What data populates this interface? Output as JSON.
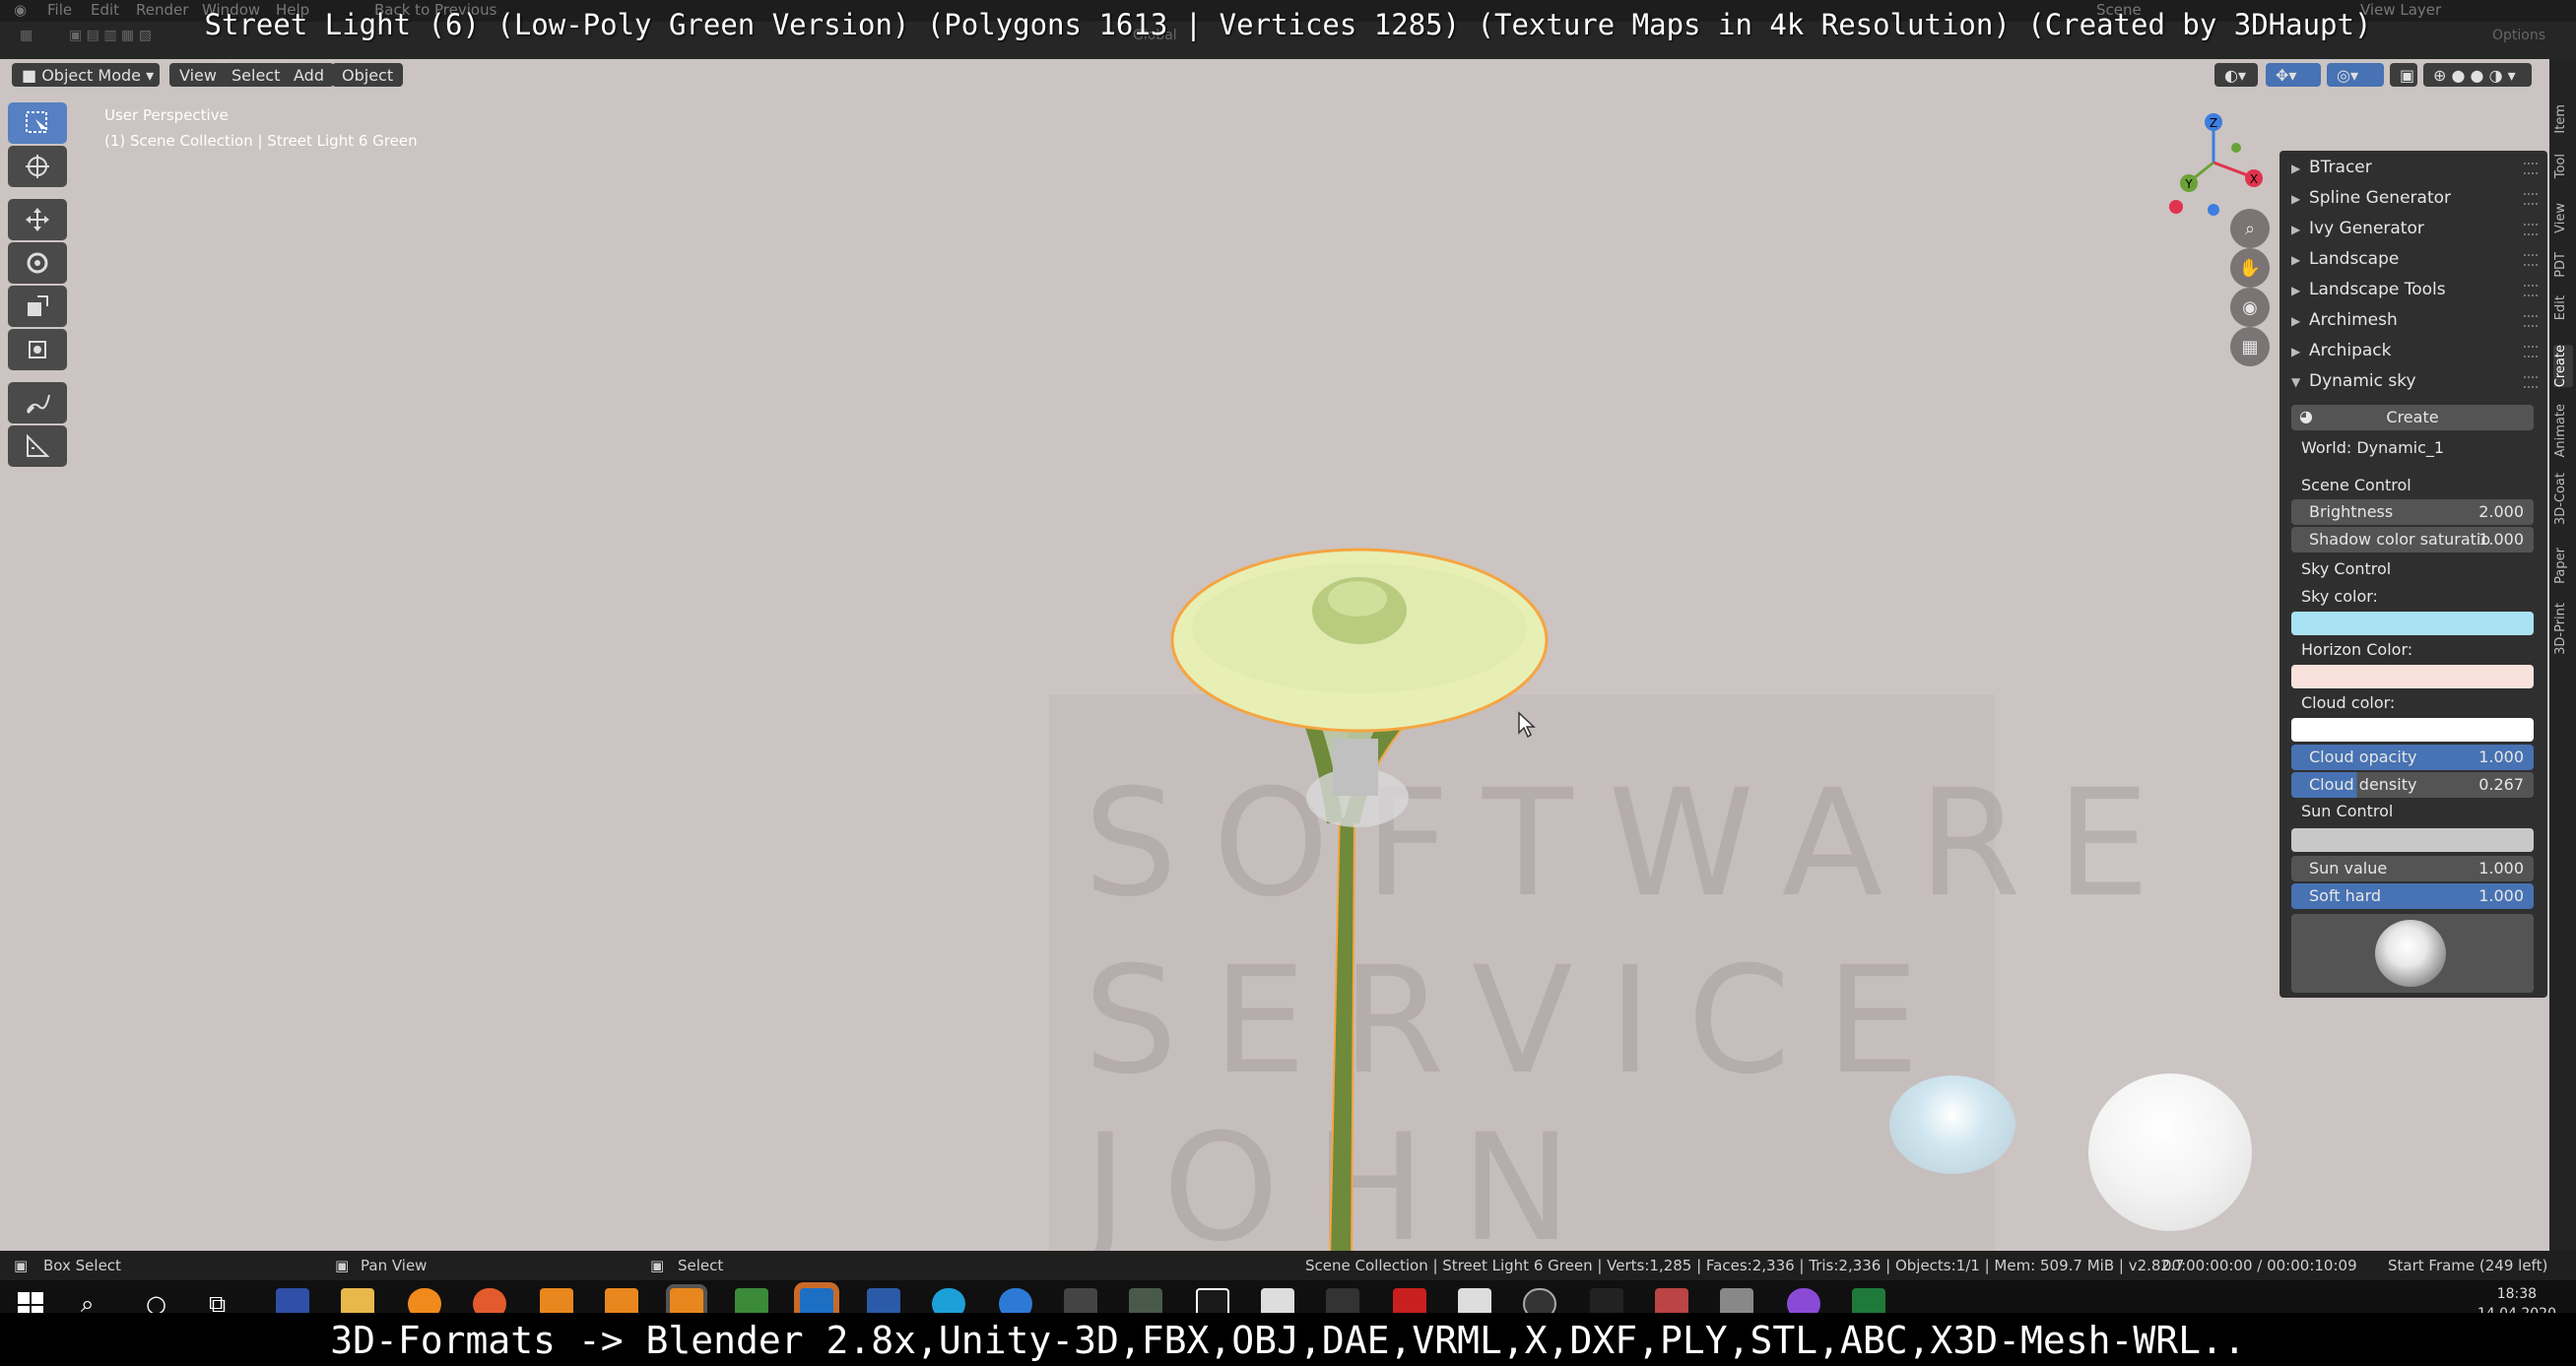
{
  "top_menu": {
    "file": "File",
    "edit": "Edit",
    "render": "Render",
    "window": "Window",
    "help": "Help",
    "back": "Back to Previous",
    "scene": "Scene",
    "view_layer": "View Layer",
    "options": "Options"
  },
  "title_overlay": "Street Light (6) (Low-Poly Green Version) (Polygons 1613 | Vertices 1285) (Texture Maps in 4k Resolution) (Created by 3DHaupt)",
  "orientation": "Global",
  "viewport_header": {
    "mode": "Object Mode",
    "view": "View",
    "select": "Select",
    "add": "Add",
    "object": "Object"
  },
  "viewport_info": {
    "perspective": "User Perspective",
    "collection": "(1) Scene Collection | Street Light 6 Green"
  },
  "toolbar": {
    "tools": [
      "select-box-icon",
      "cursor-icon",
      "move-icon",
      "rotate-icon",
      "scale-icon",
      "transform-icon",
      "annotate-icon",
      "measure-icon"
    ]
  },
  "gizmo": {
    "x": "X",
    "y": "Y",
    "z": "Z"
  },
  "watermark": {
    "line1": "SOFTWARE",
    "line2": "SERVICE",
    "line3": "JOHN"
  },
  "npanel": {
    "addons": [
      "BTracer",
      "Spline Generator",
      "Ivy Generator",
      "Landscape",
      "Landscape Tools",
      "Archimesh",
      "Archipack",
      "Dynamic sky"
    ],
    "create_button": "Create",
    "world": "World: Dynamic_1",
    "scene_control": "Scene Control",
    "brightness": {
      "label": "Brightness",
      "value": "2.000"
    },
    "shadow": {
      "label": "Shadow color saturatio",
      "value": "1.000"
    },
    "sky_control": "Sky Control",
    "sky_color_label": "Sky color:",
    "horizon_color_label": "Horizon Color:",
    "cloud_color_label": "Cloud color:",
    "cloud_opacity": {
      "label": "Cloud opacity",
      "value": "1.000"
    },
    "cloud_density": {
      "label": "Cloud density",
      "value": "0.267"
    },
    "sun_control": "Sun Control",
    "sun_value": {
      "label": "Sun value",
      "value": "1.000"
    },
    "soft_hard": {
      "label": "Soft hard",
      "value": "1.000"
    }
  },
  "colors": {
    "sky": "#a8e2f2",
    "horizon": "#f9e1dc",
    "cloud": "#ffffff",
    "accent": "#4772b3",
    "selection": "#f5a442"
  },
  "side_tabs": [
    "Item",
    "Tool",
    "View",
    "PDT",
    "Edit",
    "Create",
    "Animate",
    "3D-Coat",
    "Paper",
    "3D-Print"
  ],
  "statusbar": {
    "box_select": "Box Select",
    "pan_view": "Pan View",
    "select": "Select",
    "stats": "Scene Collection | Street Light 6 Green | Verts:1,285 | Faces:2,336 | Tris:2,336 | Objects:1/1 | Mem: 509.7 MiB | v2.82.7",
    "timecode": "00:00:00:00 / 00:00:10:09",
    "start_frame": "Start Frame (249 left)"
  },
  "taskbar": {
    "time": "18:38",
    "date": "14.04.2020"
  },
  "bottom_overlay": "3D-Formats -> Blender 2.8x,Unity-3D,FBX,OBJ,DAE,VRML,X,DXF,PLY,STL,ABC,X3D-Mesh-WRL.."
}
